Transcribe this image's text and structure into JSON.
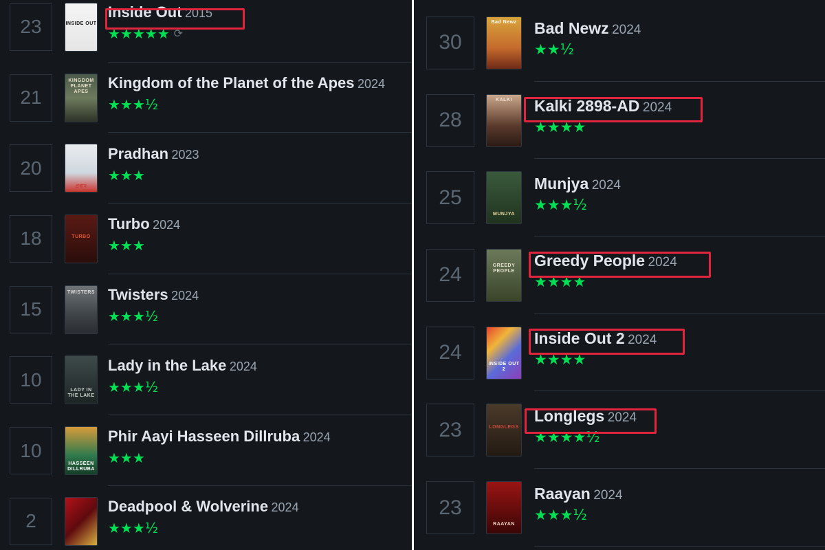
{
  "left_list": [
    {
      "rank": "23",
      "title": "Inside Out",
      "year": "2015",
      "stars": "★★★★★",
      "icon": "reload-icon",
      "highlighted": true
    },
    {
      "rank": "21",
      "title": "Kingdom of the Planet of the Apes",
      "year": "2024",
      "stars": "★★★½",
      "highlighted": false
    },
    {
      "rank": "20",
      "title": "Pradhan",
      "year": "2023",
      "stars": "★★★",
      "highlighted": false
    },
    {
      "rank": "18",
      "title": "Turbo",
      "year": "2024",
      "stars": "★★★",
      "highlighted": false
    },
    {
      "rank": "15",
      "title": "Twisters",
      "year": "2024",
      "stars": "★★★½",
      "highlighted": false
    },
    {
      "rank": "10",
      "title": "Lady in the Lake",
      "year": "2024",
      "stars": "★★★½",
      "highlighted": false
    },
    {
      "rank": "10",
      "title": "Phir Aayi Hasseen Dillruba",
      "year": "2024",
      "stars": "★★★",
      "highlighted": false
    },
    {
      "rank": "2",
      "title": "Deadpool & Wolverine",
      "year": "2024",
      "stars": "★★★½",
      "highlighted": false
    }
  ],
  "right_list": [
    {
      "rank": "30",
      "title": "Bad Newz",
      "year": "2024",
      "stars": "★★½",
      "highlighted": false
    },
    {
      "rank": "28",
      "title": "Kalki 2898-AD",
      "year": "2024",
      "stars": "★★★★",
      "highlighted": true
    },
    {
      "rank": "25",
      "title": "Munjya",
      "year": "2024",
      "stars": "★★★½",
      "highlighted": false
    },
    {
      "rank": "24",
      "title": "Greedy People",
      "year": "2024",
      "stars": "★★★★",
      "highlighted": true
    },
    {
      "rank": "24",
      "title": "Inside Out 2",
      "year": "2024",
      "stars": "★★★★",
      "highlighted": true
    },
    {
      "rank": "23",
      "title": "Longlegs",
      "year": "2024",
      "stars": "★★★★½",
      "highlighted": true
    },
    {
      "rank": "23",
      "title": "Raayan",
      "year": "2024",
      "stars": "★★★½",
      "highlighted": false
    }
  ],
  "poster_texts": {
    "inside_out": "INSIDE OUT",
    "kingdom": "KINGDOM PLANET APES",
    "pradhan": "প্রধান",
    "turbo": "TURBO",
    "twisters": "TWISTERS",
    "lady": "LADY IN THE LAKE",
    "dillruba": "HASSEEN DILLRUBA",
    "deadpool": "",
    "bad_newz": "Bad Newz",
    "kalki": "KALKI",
    "munjya": "MUNJYA",
    "greedy": "GREEDY PEOPLE",
    "inside_out_2": "INSIDE OUT 2",
    "longlegs": "LONGLEGS",
    "raayan": "RAAYAN"
  },
  "colors": {
    "background": "#14181c",
    "star_green": "#00e054",
    "highlight_red": "#e1253c",
    "title": "#dfe5ea",
    "year": "#9aa5b1"
  }
}
